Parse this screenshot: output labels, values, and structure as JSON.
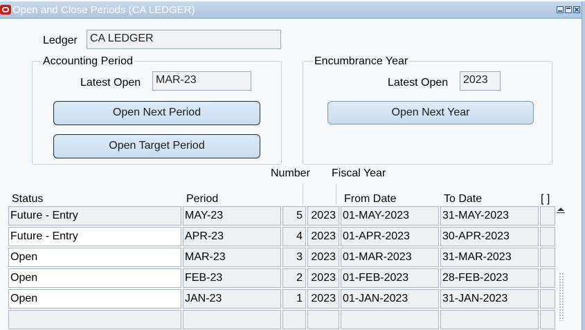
{
  "window": {
    "title": "Open and Close Periods (CA LEDGER)",
    "icon": "oracle-icon"
  },
  "ledger": {
    "label": "Ledger",
    "value": "CA LEDGER"
  },
  "accounting_period": {
    "group_label": "Accounting Period",
    "latest_open_label": "Latest Open",
    "latest_open_value": "MAR-23",
    "open_next_button": "Open Next Period",
    "open_target_button": "Open Target Period"
  },
  "encumbrance_year": {
    "group_label": "Encumbrance Year",
    "latest_open_label": "Latest Open",
    "latest_open_value": "2023",
    "open_next_button": "Open Next Year"
  },
  "table": {
    "headers": {
      "status": "Status",
      "period": "Period",
      "number": "Number",
      "fiscal_year": "Fiscal Year",
      "from_date": "From Date",
      "to_date": "To Date",
      "flex": "[ ]"
    },
    "rows": [
      {
        "status": "Future - Entry",
        "period": "MAY-23",
        "number": "5",
        "year": "2023",
        "from": "01-MAY-2023",
        "to": "31-MAY-2023"
      },
      {
        "status": "Future - Entry",
        "period": "APR-23",
        "number": "4",
        "year": "2023",
        "from": "01-APR-2023",
        "to": "30-APR-2023"
      },
      {
        "status": "Open",
        "period": "MAR-23",
        "number": "3",
        "year": "2023",
        "from": "01-MAR-2023",
        "to": "31-MAR-2023"
      },
      {
        "status": "Open",
        "period": "FEB-23",
        "number": "2",
        "year": "2023",
        "from": "01-FEB-2023",
        "to": "28-FEB-2023"
      },
      {
        "status": "Open",
        "period": "JAN-23",
        "number": "1",
        "year": "2023",
        "from": "01-JAN-2023",
        "to": "31-JAN-2023"
      },
      {
        "status": "",
        "period": "",
        "number": "",
        "year": "",
        "from": "",
        "to": ""
      }
    ]
  }
}
